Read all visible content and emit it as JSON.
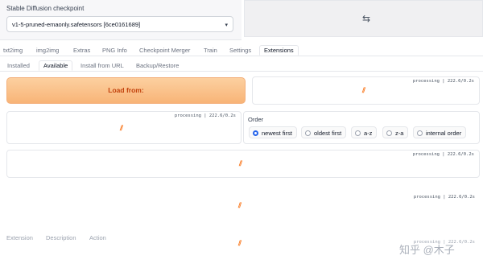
{
  "checkpoint": {
    "label": "Stable Diffusion checkpoint",
    "value": "v1-5-pruned-emaonly.safetensors [6ce0161689]",
    "caret": "▾"
  },
  "swap_icon": "⇆",
  "tabs": [
    "txt2img",
    "img2img",
    "Extras",
    "PNG Info",
    "Checkpoint Merger",
    "Train",
    "Settings",
    "Extensions"
  ],
  "active_tab": "Extensions",
  "subtabs": [
    "Installed",
    "Available",
    "Install from URL",
    "Backup/Restore"
  ],
  "active_subtab": "Available",
  "load_button": "Load from:",
  "status_text": "processing | 222.6/0.2s",
  "spinner_icon": "⫽",
  "order": {
    "label": "Order",
    "options": [
      "newest first",
      "oldest first",
      "a-z",
      "z-a",
      "internal order"
    ],
    "selected": "newest first"
  },
  "table_headers": [
    "Extension",
    "Description",
    "Action"
  ],
  "watermark": "知乎 @木子"
}
